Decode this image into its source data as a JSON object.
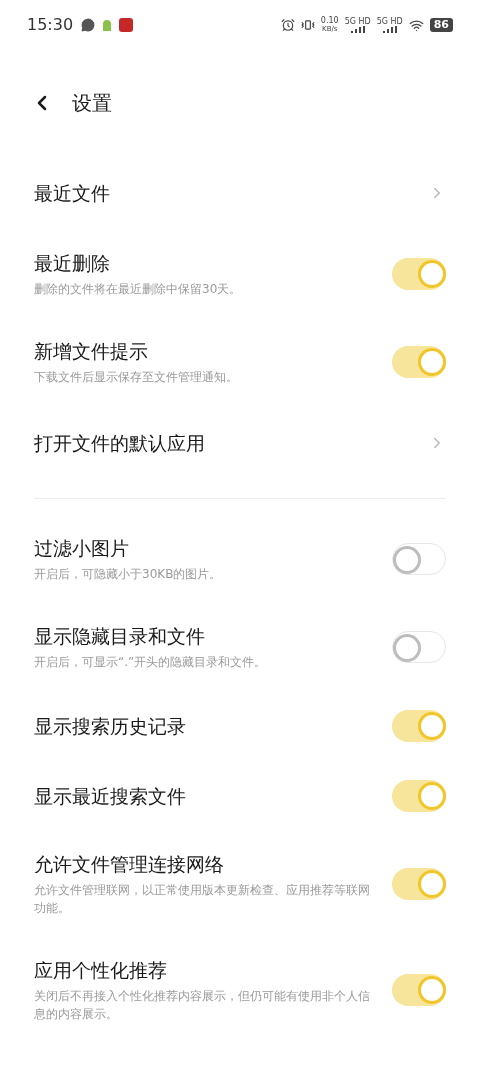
{
  "status_bar": {
    "time": "15:30",
    "speed_value": "0.10",
    "speed_unit": "KB/s",
    "signals": [
      {
        "label": "5G HD"
      },
      {
        "label": "5G HD"
      }
    ],
    "battery": "86"
  },
  "header": {
    "title": "设置"
  },
  "sections": [
    {
      "rows": [
        {
          "kind": "link",
          "title": "最近文件"
        },
        {
          "kind": "toggle",
          "title": "最近删除",
          "subtitle": "删除的文件将在最近删除中保留30天。",
          "on": true
        },
        {
          "kind": "toggle",
          "title": "新增文件提示",
          "subtitle": "下载文件后显示保存至文件管理通知。",
          "on": true
        },
        {
          "kind": "link",
          "title": "打开文件的默认应用"
        }
      ]
    },
    {
      "rows": [
        {
          "kind": "toggle",
          "title": "过滤小图片",
          "subtitle": "开启后，可隐藏小于30KB的图片。",
          "on": false
        },
        {
          "kind": "toggle",
          "title": "显示隐藏目录和文件",
          "subtitle": "开启后，可显示“.”开头的隐藏目录和文件。",
          "on": false
        },
        {
          "kind": "toggle",
          "title": "显示搜索历史记录",
          "on": true
        },
        {
          "kind": "toggle",
          "title": "显示最近搜索文件",
          "on": true
        },
        {
          "kind": "toggle",
          "title": "允许文件管理连接网络",
          "subtitle": "允许文件管理联网，以正常使用版本更新检查、应用推荐等联网功能。",
          "on": true
        },
        {
          "kind": "toggle",
          "title": "应用个性化推荐",
          "subtitle": "关闭后不再接入个性化推荐内容展示，但仍可能有使用非个人信息的内容展示。",
          "on": true
        }
      ]
    }
  ]
}
